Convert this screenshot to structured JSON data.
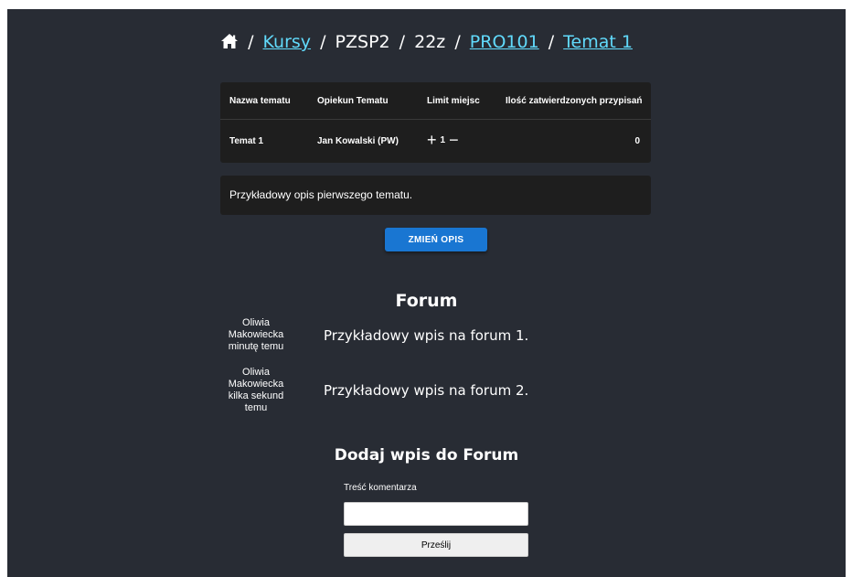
{
  "breadcrumb": {
    "separator": "/",
    "kursy": "Kursy",
    "course_code": "PZSP2",
    "semester": "22z",
    "subject": "PRO101",
    "topic": "Temat 1"
  },
  "table": {
    "headers": {
      "name": "Nazwa tematu",
      "owner": "Opiekun Tematu",
      "limit": "Limit miejsc",
      "approved": "Ilość zatwierdzonych przypisań"
    },
    "rows": [
      {
        "name": "Temat 1",
        "owner": "Jan Kowalski (PW)",
        "limit": "1",
        "approved": "0"
      }
    ]
  },
  "description": "Przykładowy opis pierwszego tematu.",
  "change_description_button": "ZMIEŃ OPIS",
  "forum": {
    "title": "Forum",
    "posts": [
      {
        "author_first": "Oliwia",
        "author_last": "Makowiecka",
        "time": "minutę temu",
        "text": "Przykładowy wpis na forum 1."
      },
      {
        "author_first": "Oliwia",
        "author_last": "Makowiecka",
        "time": "kilka sekund temu",
        "text": "Przykładowy wpis na forum 2."
      }
    ]
  },
  "add_post": {
    "title": "Dodaj wpis do Forum",
    "label": "Treść komentarza",
    "input_value": "",
    "submit": "Prześlij"
  },
  "icons": {
    "home": "home-icon",
    "plus": "plus-icon",
    "minus": "minus-icon"
  },
  "colors": {
    "background": "#282c34",
    "panel": "#1e1e1e",
    "link": "#61dafb",
    "primary_button": "#1976d2"
  }
}
